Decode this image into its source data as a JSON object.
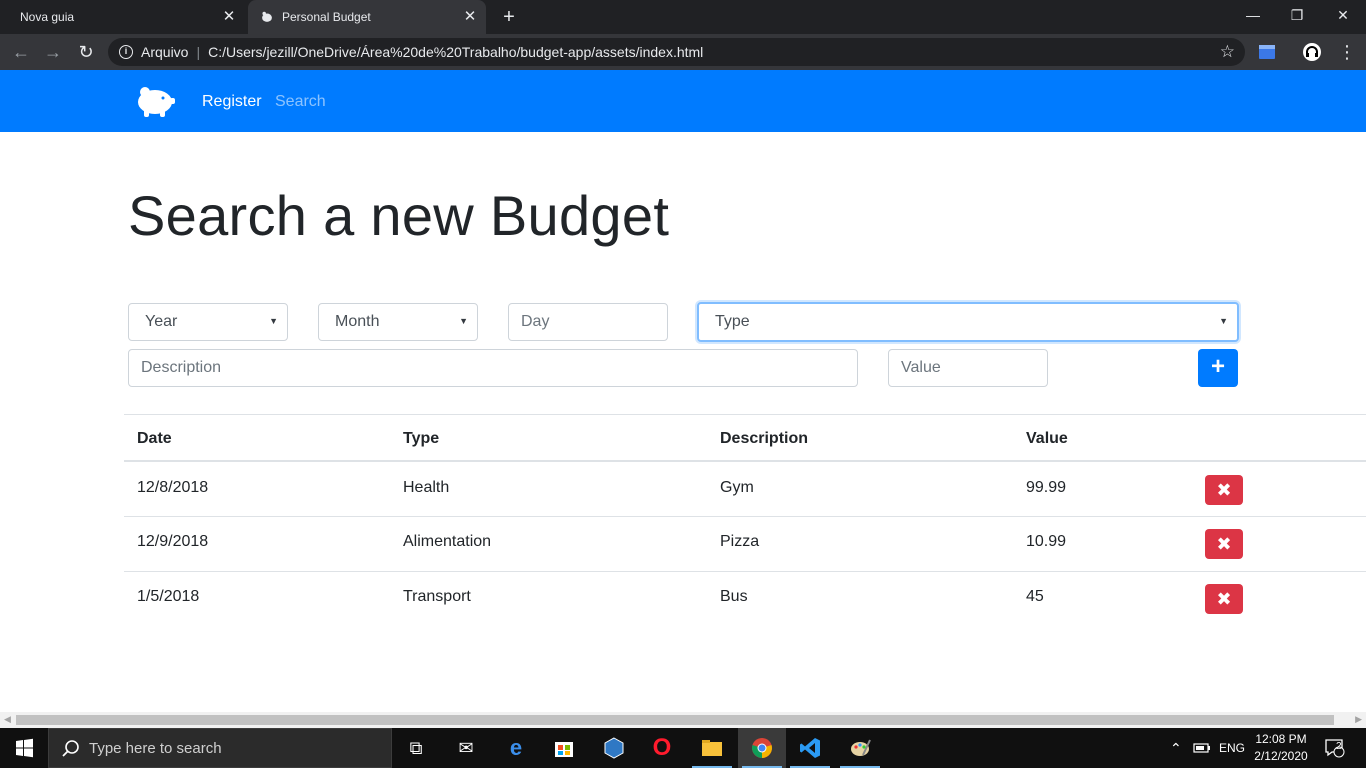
{
  "browser": {
    "tabs": [
      {
        "title": "Nova guia",
        "active": false
      },
      {
        "title": "Personal Budget",
        "active": true
      }
    ],
    "new_tab": "+",
    "window_controls": {
      "minimize": "—",
      "restore": "❐",
      "close": "✕"
    },
    "address": {
      "security_label": "Arquivo",
      "url": "C:/Users/jezill/OneDrive/Área%20de%20Trabalho/budget-app/assets/index.html"
    }
  },
  "navbar": {
    "brand_icon": "piggy-bank-icon",
    "links": [
      {
        "label": "Register",
        "active": true
      },
      {
        "label": "Search",
        "active": false
      }
    ],
    "color": "#007bff"
  },
  "page": {
    "title": "Search a new Budget"
  },
  "form": {
    "year_select": "Year",
    "month_select": "Month",
    "day_placeholder": "Day",
    "type_select": "Type",
    "description_placeholder": "Description",
    "value_placeholder": "Value",
    "add_button_icon": "+"
  },
  "table": {
    "headers": [
      "Date",
      "Type",
      "Description",
      "Value"
    ],
    "rows": [
      {
        "date": "12/8/2018",
        "type": "Health",
        "description": "Gym",
        "value": "99.99"
      },
      {
        "date": "12/9/2018",
        "type": "Alimentation",
        "description": "Pizza",
        "value": "10.99"
      },
      {
        "date": "1/5/2018",
        "type": "Transport",
        "description": "Bus",
        "value": "45"
      }
    ],
    "delete_icon": "✖",
    "delete_color": "#dc3545"
  },
  "taskbar": {
    "search_placeholder": "Type here to search",
    "language": "ENG",
    "time": "12:08 PM",
    "date": "2/12/2020",
    "notifications": "2"
  }
}
